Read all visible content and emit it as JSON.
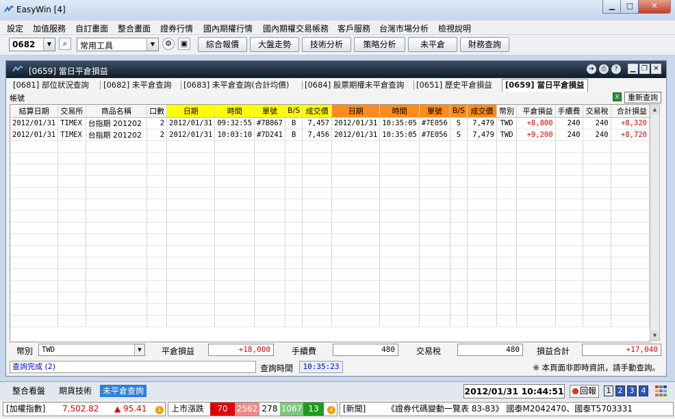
{
  "window": {
    "title": "EasyWin  [4]"
  },
  "menu": [
    "設定",
    "加值服務",
    "自訂畫面",
    "整合畫面",
    "證券行情",
    "國內期權行情",
    "國內期權交易帳務",
    "客戶服務",
    "台灣市場分析",
    "檢視說明"
  ],
  "toolbar": {
    "code_value": "0682",
    "tools_value": "常用工具",
    "buttons": [
      "綜合報價",
      "大盤走勢",
      "技術分析",
      "策略分析",
      "未平倉",
      "財務查詢"
    ]
  },
  "panel": {
    "title": "[0659] 當日平倉損益",
    "tabs": [
      "[0681] 部位狀況查詢",
      "[0682] 未平倉查詢",
      "[0683] 未平倉查詢(合計均價)",
      "[0684] 股票期權未平倉查詢",
      "[0651] 歷史平倉損益",
      "[0659] 當日平倉損益"
    ],
    "account_label": "帳號",
    "refresh_label": "重新查詢"
  },
  "table": {
    "headers": [
      "結算日期",
      "交易所",
      "商品名稱",
      "口數",
      "日期",
      "時間",
      "單號",
      "B/S",
      "成交價",
      "日期",
      "時間",
      "單號",
      "B/S",
      "成交價",
      "幣別",
      "平倉損益",
      "手續費",
      "交易稅",
      "合計損益"
    ],
    "rows": [
      [
        "2012/01/31",
        "TIMEX",
        "台指期 201202",
        "2",
        "2012/01/31",
        "09:32:55",
        "#7B867",
        "B",
        "7,457",
        "2012/01/31",
        "10:35:05",
        "#7E056",
        "S",
        "7,479",
        "TWD",
        "+8,800",
        "240",
        "240",
        "+8,320"
      ],
      [
        "2012/01/31",
        "TIMEX",
        "台指期 201202",
        "2",
        "2012/01/31",
        "10:03:10",
        "#7D241",
        "B",
        "7,456",
        "2012/01/31",
        "10:35:05",
        "#7E056",
        "S",
        "7,479",
        "TWD",
        "+9,200",
        "240",
        "240",
        "+8,720"
      ]
    ]
  },
  "summary": {
    "currency_label": "幣別",
    "currency_value": "TWD",
    "pnl_label": "平倉損益",
    "pnl_value": "+18,000",
    "fee_label": "手續費",
    "fee_value": "480",
    "tax_label": "交易稅",
    "tax_value": "480",
    "total_label": "損益合計",
    "total_value": "+17,040"
  },
  "status": {
    "message": "查詢完成 (2)",
    "time_label": "查詢時間",
    "time_value": "10:35:23",
    "note": "※ 本頁面非即時資訊，請手動查詢。"
  },
  "bottom_tabs": [
    "整合看盤",
    "期貨技術",
    "未平倉查詢"
  ],
  "clock": "2012/01/31 10:44:51",
  "huibao": "回報",
  "page_buttons": [
    "1",
    "2",
    "3",
    "4"
  ],
  "ticker": {
    "index_label": "[加權指數]",
    "index_value": "7,502.82",
    "change": "▲ 95.41",
    "updown_label": "上市漲跌",
    "up_limit": "70",
    "up": "2562",
    "flat": "278",
    "down": "1067",
    "down_limit": "13",
    "news_label": "[新聞]",
    "news": "《證券代碼變動一覽表  83-83》 國泰M2042470、國泰T5703331"
  },
  "colors": {
    "accent_blue": "#2f7fd8",
    "yellow_header": "#ffff00",
    "orange_header": "#ff8c1a",
    "profit_red": "#e00000"
  }
}
